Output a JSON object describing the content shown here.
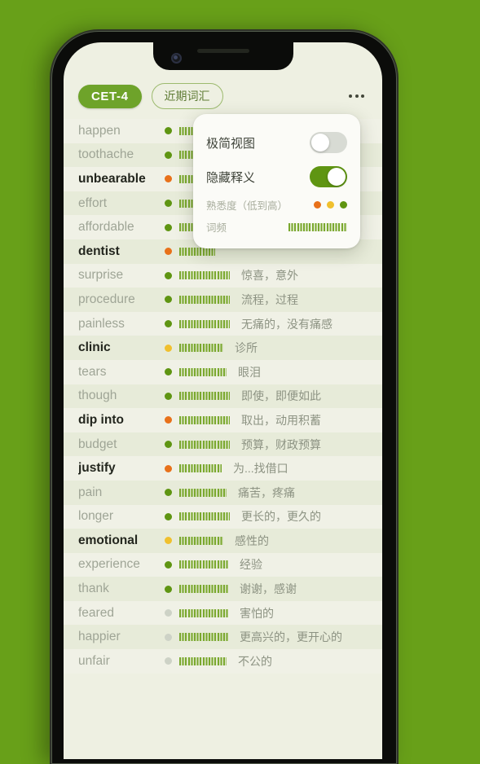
{
  "background_color": "#68a019",
  "screen_background": "#eef0e2",
  "header": {
    "level_badge": "CET-4",
    "filter_pill": "近期词汇",
    "more_menu_icon": "more-horizontal-icon"
  },
  "settings_popup": {
    "rows": [
      {
        "label": "极简视图",
        "state": "off"
      },
      {
        "label": "隐藏释义",
        "state": "on"
      }
    ],
    "legend": {
      "familiarity_label": "熟悉度（低到高）",
      "familiarity_colors": [
        "#e8711a",
        "#f0c02e",
        "#5f9512"
      ],
      "frequency_label": "词频",
      "frequency_bar_color": "#7aa82e"
    }
  },
  "colors": {
    "dot_low": "#e8711a",
    "dot_mid": "#f0c02e",
    "dot_high": "#5f9512",
    "dot_none": "#cdd2c6",
    "accent_green": "#6ea32a",
    "toggle_on": "#5f9512",
    "toggle_off": "#d8dbd4"
  },
  "word_list": [
    {
      "term": "happen",
      "dot": "#5f9512",
      "freq": 44,
      "def": "",
      "bold": false
    },
    {
      "term": "toothache",
      "dot": "#5f9512",
      "freq": 44,
      "def": "",
      "bold": false
    },
    {
      "term": "unbearable",
      "dot": "#e8711a",
      "freq": 44,
      "def": "",
      "bold": true
    },
    {
      "term": "effort",
      "dot": "#5f9512",
      "freq": 44,
      "def": "",
      "bold": false
    },
    {
      "term": "affordable",
      "dot": "#5f9512",
      "freq": 44,
      "def": "",
      "bold": false
    },
    {
      "term": "dentist",
      "dot": "#e8711a",
      "freq": 44,
      "def": "",
      "bold": true
    },
    {
      "term": "surprise",
      "dot": "#5f9512",
      "freq": 62,
      "def": "惊喜，意外",
      "bold": false
    },
    {
      "term": "procedure",
      "dot": "#5f9512",
      "freq": 62,
      "def": "流程，过程",
      "bold": false
    },
    {
      "term": "painless",
      "dot": "#5f9512",
      "freq": 62,
      "def": "无痛的，没有痛感",
      "bold": false
    },
    {
      "term": "clinic",
      "dot": "#f0c02e",
      "freq": 54,
      "def": "诊所",
      "bold": true
    },
    {
      "term": "tears",
      "dot": "#5f9512",
      "freq": 58,
      "def": "眼泪",
      "bold": false
    },
    {
      "term": "though",
      "dot": "#5f9512",
      "freq": 62,
      "def": "即使，即便如此",
      "bold": false
    },
    {
      "term": "dip into",
      "dot": "#e8711a",
      "freq": 62,
      "def": "取出，动用积蓄",
      "bold": true
    },
    {
      "term": "budget",
      "dot": "#5f9512",
      "freq": 62,
      "def": "预算，财政预算",
      "bold": false
    },
    {
      "term": "justify",
      "dot": "#e8711a",
      "freq": 52,
      "def": "为...找借口",
      "bold": true
    },
    {
      "term": "pain",
      "dot": "#5f9512",
      "freq": 58,
      "def": "痛苦，疼痛",
      "bold": false
    },
    {
      "term": "longer",
      "dot": "#5f9512",
      "freq": 62,
      "def": "更长的，更久的",
      "bold": false
    },
    {
      "term": "emotional",
      "dot": "#f0c02e",
      "freq": 54,
      "def": "感性的",
      "bold": true
    },
    {
      "term": "experience",
      "dot": "#5f9512",
      "freq": 60,
      "def": "经验",
      "bold": false
    },
    {
      "term": "thank",
      "dot": "#5f9512",
      "freq": 60,
      "def": "谢谢，感谢",
      "bold": false
    },
    {
      "term": "feared",
      "dot": "#cdd2c6",
      "freq": 60,
      "def": "害怕的",
      "bold": false
    },
    {
      "term": "happier",
      "dot": "#cdd2c6",
      "freq": 60,
      "def": "更高兴的，更开心的",
      "bold": false
    },
    {
      "term": "unfair",
      "dot": "#cdd2c6",
      "freq": 58,
      "def": "不公的",
      "bold": false
    }
  ]
}
